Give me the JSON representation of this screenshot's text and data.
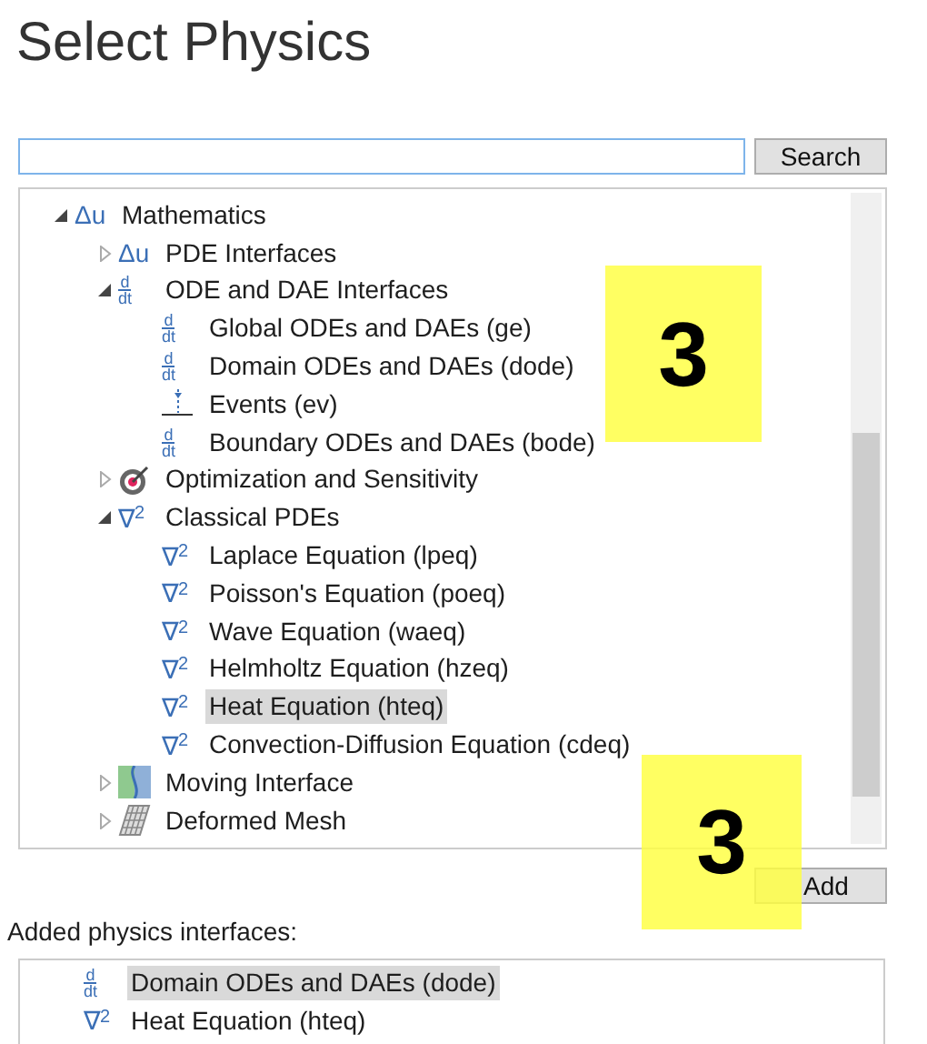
{
  "title": "Select Physics",
  "search_button": "Search",
  "tree": {
    "items": [
      {
        "label": "Mathematics",
        "kind": "symbol",
        "symbol": "Δu",
        "expanded": true,
        "selected": false,
        "children": [
          {
            "label": "PDE Interfaces",
            "kind": "symbol",
            "symbol": "Δu",
            "expanded": false,
            "selected": false
          },
          {
            "label": "ODE and DAE Interfaces",
            "kind": "fraction",
            "top": "d",
            "bottom": "dt",
            "expanded": true,
            "selected": false,
            "children": [
              {
                "label": "Global ODEs and DAEs (ge)",
                "kind": "fraction",
                "top": "d",
                "bottom": "dt",
                "selected": false
              },
              {
                "label": "Domain ODEs and DAEs (dode)",
                "kind": "fraction",
                "top": "d",
                "bottom": "dt",
                "selected": false
              },
              {
                "label": "Events (ev)",
                "kind": "events",
                "selected": false
              },
              {
                "label": "Boundary ODEs and DAEs (bode)",
                "kind": "fraction",
                "top": "d",
                "bottom": "dt",
                "selected": false
              }
            ]
          },
          {
            "label": "Optimization and Sensitivity",
            "kind": "target",
            "expanded": false,
            "selected": false
          },
          {
            "label": "Classical PDEs",
            "kind": "symbol",
            "symbol": "∇$^{2}$",
            "expanded": true,
            "selected": false,
            "children": [
              {
                "label": "Laplace Equation (lpeq)",
                "kind": "symbol",
                "symbol": "∇$^{2}$",
                "selected": false
              },
              {
                "label": "Poisson's Equation (poeq)",
                "kind": "symbol",
                "symbol": "∇$^{2}$",
                "selected": false
              },
              {
                "label": "Wave Equation (waeq)",
                "kind": "symbol",
                "symbol": "∇$^{2}$",
                "selected": false
              },
              {
                "label": "Helmholtz Equation (hzeq)",
                "kind": "symbol",
                "symbol": "∇$^{2}$",
                "selected": false
              },
              {
                "label": "Heat Equation (hteq)",
                "kind": "symbol",
                "symbol": "∇$^{2}$",
                "selected": true
              },
              {
                "label": "Convection-Diffusion Equation (cdeq)",
                "kind": "symbol",
                "symbol": "∇$^{2}$",
                "selected": false
              }
            ]
          },
          {
            "label": "Moving Interface",
            "kind": "moving",
            "expanded": false,
            "selected": false
          },
          {
            "label": "Deformed Mesh",
            "kind": "mesh",
            "expanded": false,
            "selected": false
          }
        ]
      }
    ]
  },
  "add_button": "Add",
  "added_label": "Added physics interfaces:",
  "added": [
    {
      "label": "Domain ODEs and DAEs (dode)",
      "kind": "fraction",
      "top": "d",
      "bottom": "dt",
      "selected": true
    },
    {
      "label": "Heat Equation (hteq)",
      "kind": "symbol",
      "symbol": "∇$^{2}$",
      "selected": false
    }
  ],
  "callouts": [
    {
      "text": "3"
    },
    {
      "text": "3"
    }
  ]
}
